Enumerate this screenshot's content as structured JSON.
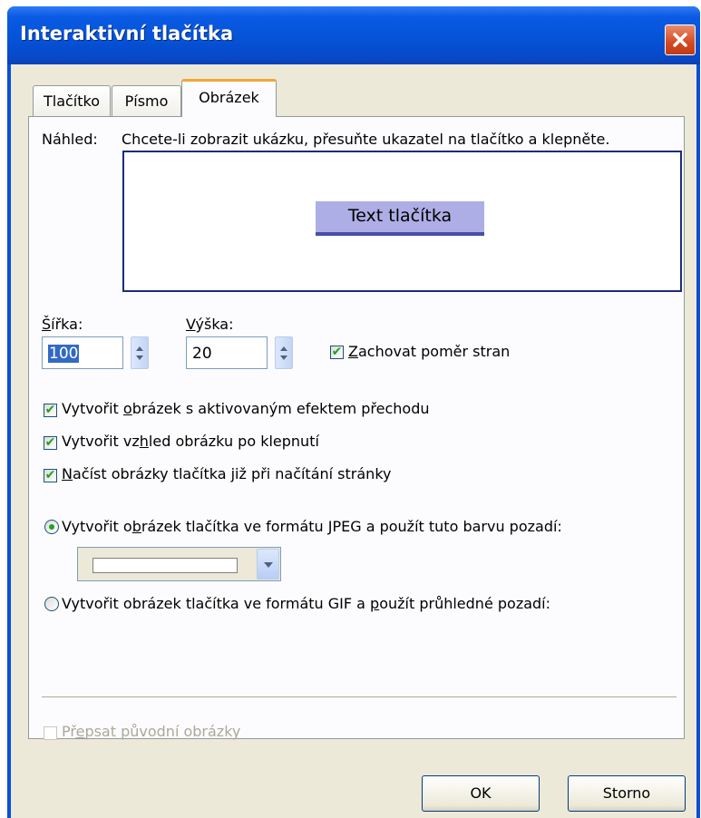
{
  "window": {
    "title": "Interaktivní tlačítka"
  },
  "tabs": [
    {
      "label": "Tlačítko",
      "active": false
    },
    {
      "label": "Písmo",
      "active": false
    },
    {
      "label": "Obrázek",
      "active": true
    }
  ],
  "preview": {
    "label": "Náhled:",
    "hint": "Chcete-li zobrazit ukázku, přesuňte ukazatel na tlačítko a klepněte.",
    "button_text": "Text tlačítka"
  },
  "size": {
    "width_label": "Šířka:",
    "width_value": "100",
    "height_label": "Výška:",
    "height_value": "20",
    "keep_ratio_label": "Zachovat poměr stran",
    "keep_ratio_checked": true
  },
  "options": [
    {
      "label": "Vytvořit obrázek s aktivovaným efektem přechodu",
      "checked": true
    },
    {
      "label": "Vytvořit vzhled obrázku po klepnutí",
      "checked": true
    },
    {
      "label": "Načíst obrázky tlačítka již při načítání stránky",
      "checked": true
    }
  ],
  "format": {
    "jpeg_label": "Vytvořit obrázek tlačítka ve formátu JPEG a použít tuto barvu pozadí:",
    "jpeg_selected": true,
    "bg_color": "#ffffff",
    "gif_label": "Vytvořit obrázek tlačítka ve formátu GIF a použít průhledné pozadí:",
    "gif_selected": false
  },
  "overwrite": {
    "label": "Přepsat původní obrázky",
    "enabled": false
  },
  "buttons": {
    "ok": "OK",
    "cancel": "Storno"
  },
  "colors": {
    "titlebar": "#0553d8",
    "dialog_bg": "#ece9d8",
    "preview_button_bg": "#adaee6",
    "check_mark": "#21a121",
    "active_tab_accent": "#f2a53a"
  }
}
